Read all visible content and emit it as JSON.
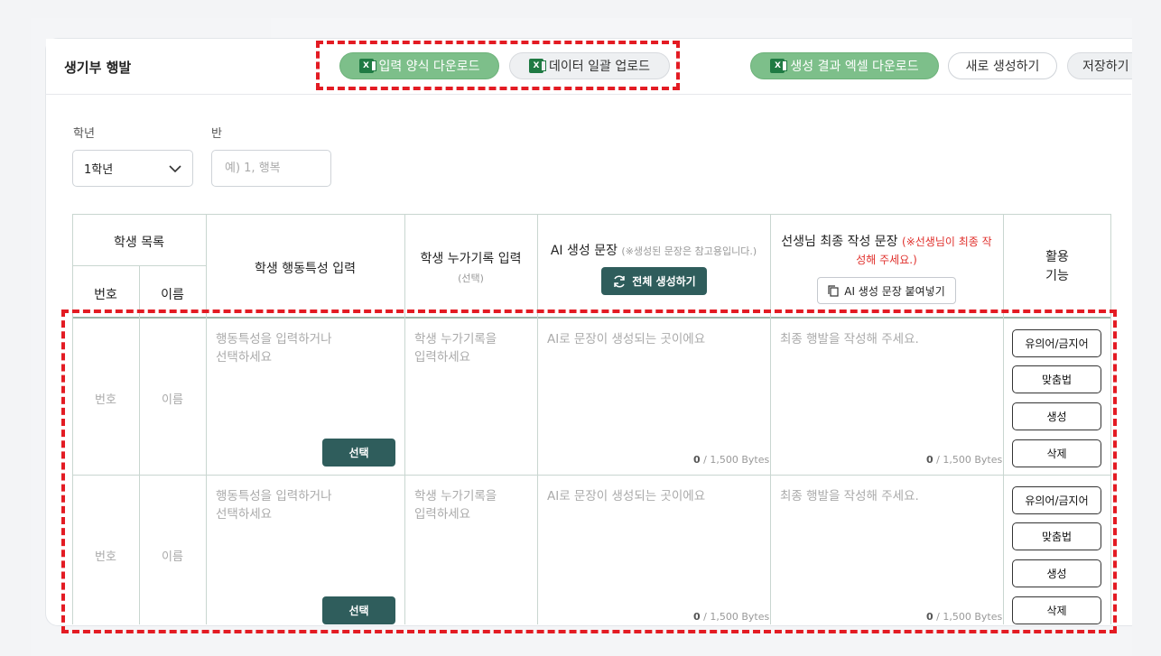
{
  "header": {
    "title": "생기부 행발",
    "buttons": {
      "template_download": "입력 양식 다운로드",
      "bulk_upload": "데이터 일괄 업로드",
      "excel_download": "생성 결과 엑셀 다운로드",
      "new_generate": "새로 생성하기",
      "save": "저장하기"
    },
    "xls_glyph": "X"
  },
  "filters": {
    "grade_label": "학년",
    "grade_value": "1학년",
    "class_label": "반",
    "class_placeholder": "예) 1, 행복"
  },
  "table": {
    "headers": {
      "student_list": "학생 목록",
      "number": "번호",
      "name": "이름",
      "behavior": "학생 행동특성 입력",
      "cumulative": "학생 누가기록 입력",
      "cumulative_sub": "(선택)",
      "ai": "AI 생성 문장",
      "ai_sub": "(※생성된 문장은 참고용입니다.)",
      "generate_all": "전체 생성하기",
      "teacher": "선생님 최종 작성 문장",
      "teacher_note_1": "(※선생님이 최종 작",
      "teacher_note_2": "성해 주세요.)",
      "paste_ai": "AI 생성 문장 붙여넣기",
      "functions_1": "활용",
      "functions_2": "기능"
    },
    "rows": [
      {
        "number": "번호",
        "name": "이름",
        "behavior_placeholder_1": "행동특성을 입력하거나",
        "behavior_placeholder_2": "선택하세요",
        "select_label": "선택",
        "cumulative_placeholder_1": "학생 누가기록을",
        "cumulative_placeholder_2": "입력하세요",
        "ai_placeholder": "AI로 문장이 생성되는 곳이에요",
        "teacher_placeholder": "최종 행발을 작성해 주세요.",
        "ai_bytes_count": "0",
        "ai_bytes_total": " / 1,500 Bytes",
        "teacher_bytes_count": "0",
        "teacher_bytes_total": " / 1,500 Bytes",
        "actions": [
          "유의어/금지어",
          "맞춤법",
          "생성",
          "삭제"
        ]
      },
      {
        "number": "번호",
        "name": "이름",
        "behavior_placeholder_1": "행동특성을 입력하거나",
        "behavior_placeholder_2": "선택하세요",
        "select_label": "선택",
        "cumulative_placeholder_1": "학생 누가기록을",
        "cumulative_placeholder_2": "입력하세요",
        "ai_placeholder": "AI로 문장이 생성되는 곳이에요",
        "teacher_placeholder": "최종 행발을 작성해 주세요.",
        "ai_bytes_count": "0",
        "ai_bytes_total": " / 1,500 Bytes",
        "teacher_bytes_count": "0",
        "teacher_bytes_total": " / 1,500 Bytes",
        "actions": [
          "유의어/금지어",
          "맞춤법",
          "생성",
          "삭제"
        ]
      }
    ]
  },
  "colors": {
    "accent_green": "#7dbf8a",
    "dark_teal": "#2f5d5c",
    "annotation_red": "#e31b23",
    "warning_red": "#e0312d"
  }
}
